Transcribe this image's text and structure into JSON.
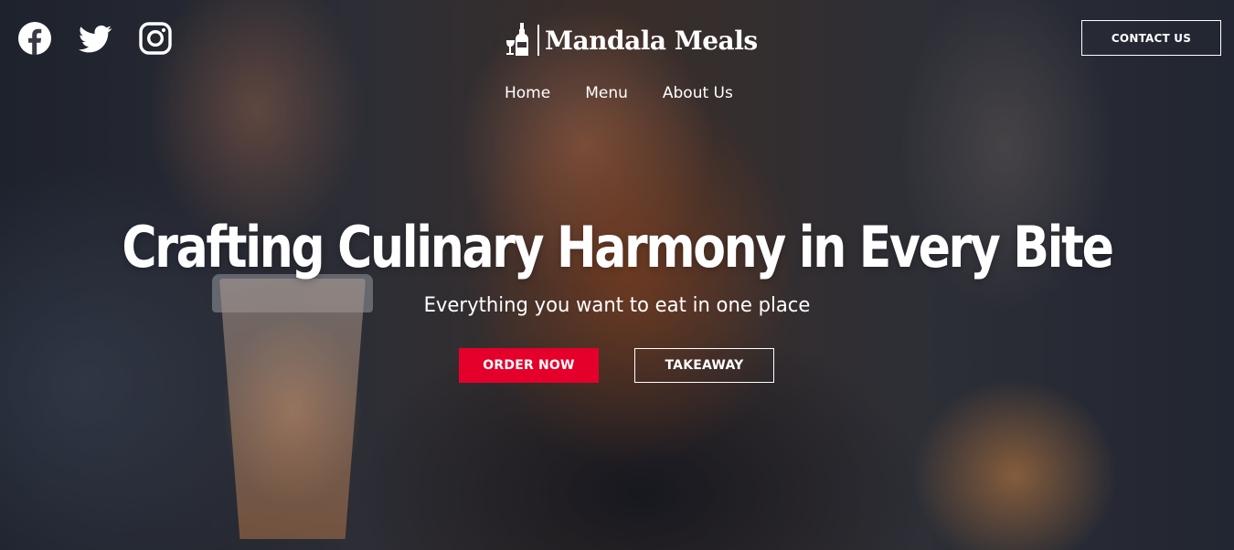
{
  "colors": {
    "accent": "#e4002b",
    "text": "#ffffff"
  },
  "header": {
    "social": [
      {
        "icon": "facebook-icon"
      },
      {
        "icon": "twitter-icon"
      },
      {
        "icon": "instagram-icon"
      }
    ],
    "brand": {
      "icon": "wine-bottle-glass-icon",
      "name": "Mandala Meals"
    },
    "nav": [
      {
        "label": "Home"
      },
      {
        "label": "Menu"
      },
      {
        "label": "About Us"
      }
    ],
    "contact_label": "CONTACT US"
  },
  "hero": {
    "headline": "Crafting Culinary Harmony in Every Bite",
    "subline": "Everything you want to eat in one place",
    "primary_cta": "ORDER NOW",
    "secondary_cta": "TAKEAWAY"
  }
}
